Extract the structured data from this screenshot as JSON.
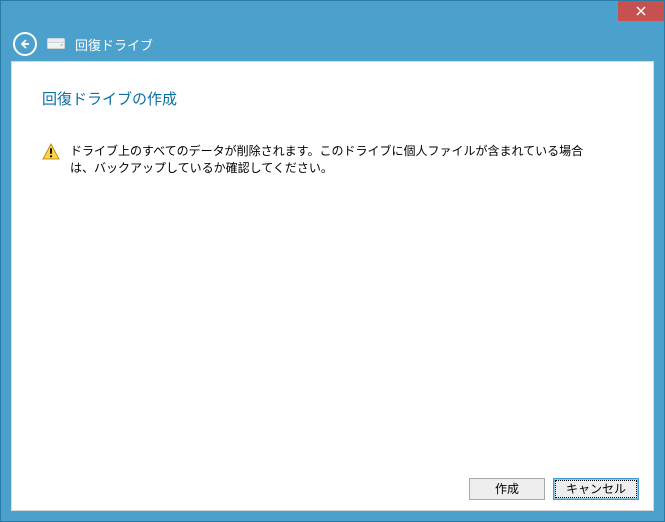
{
  "window": {
    "header_title": "回復ドライブ"
  },
  "page": {
    "title": "回復ドライブの作成",
    "warning_text": "ドライブ上のすべてのデータが削除されます。このドライブに個人ファイルが含まれている場合は、バックアップしているか確認してください。"
  },
  "buttons": {
    "create": "作成",
    "cancel": "キャンセル"
  }
}
